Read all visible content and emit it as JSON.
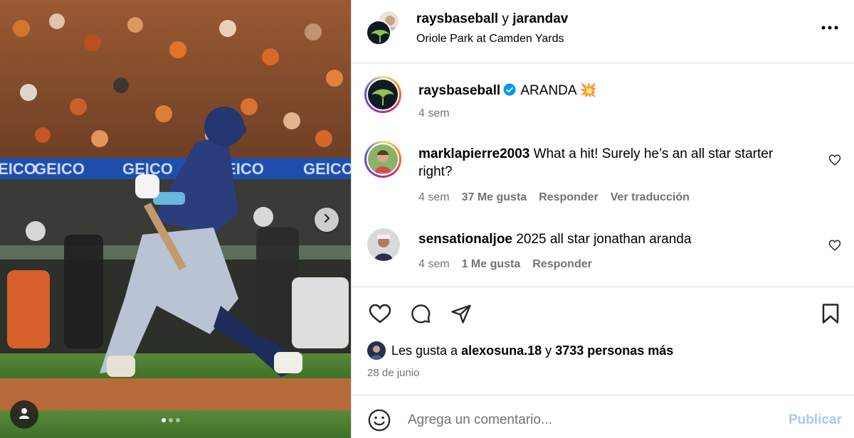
{
  "header": {
    "user1": "raysbaseball",
    "conjunction": "y",
    "user2": "jarandav",
    "location": "Oriole Park at Camden Yards"
  },
  "caption": {
    "username": "raysbaseball",
    "text": "ARANDA",
    "emoji": "💥",
    "time": "4 sem"
  },
  "comments": [
    {
      "username": "marklapierre2003",
      "text": "What a hit! Surely he’s an all star starter right?",
      "time": "4 sem",
      "likes": "37 Me gusta",
      "reply": "Responder",
      "translate": "Ver traducción"
    },
    {
      "username": "sensationaljoe",
      "text": "2025 all star jonathan aranda",
      "time": "4 sem",
      "likes": "1 Me gusta",
      "reply": "Responder"
    }
  ],
  "likes_summary": {
    "prefix": "Les gusta a",
    "user": "alexosuna.18",
    "middle": "y",
    "count": "3733 personas más"
  },
  "date": "28 de junio",
  "add_comment": {
    "placeholder": "Agrega un comentario...",
    "publish_label": "Publicar"
  },
  "media": {
    "banner_text": "GEICO",
    "carousel_dots": 3,
    "active_dot": 1
  },
  "colors": {
    "verified": "#0095f6",
    "publish_disabled": "#a8c9f5",
    "meta_text": "#737373",
    "divider": "#dbdbdb"
  },
  "icons": [
    "more-icon",
    "verified-icon",
    "heart-icon",
    "comment-icon",
    "share-icon",
    "bookmark-icon",
    "emoji-icon",
    "chevron-right-icon",
    "user-tag-icon"
  ]
}
